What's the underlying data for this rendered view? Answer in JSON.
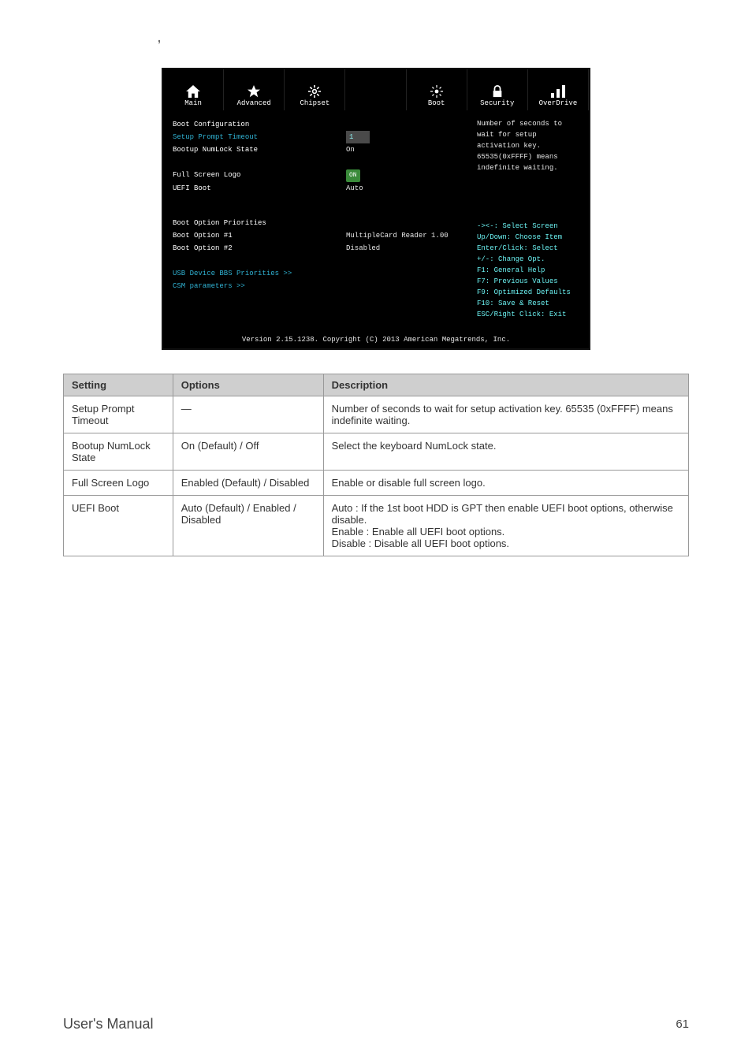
{
  "comma": ",",
  "bios": {
    "tabs": [
      {
        "label": "Main",
        "icon": "home"
      },
      {
        "label": "Advanced",
        "icon": "star"
      },
      {
        "label": "Chipset",
        "icon": "gear"
      },
      {
        "label": "",
        "icon": ""
      },
      {
        "label": "Boot",
        "icon": "sun"
      },
      {
        "label": "Security",
        "icon": "lock"
      },
      {
        "label": "OverDrive",
        "icon": "bars"
      }
    ],
    "boot_config_header": "Boot Configuration",
    "setup_prompt_label": "Setup Prompt Timeout",
    "setup_prompt_val": "1",
    "numlock_label": "Bootup NumLock State",
    "numlock_val": "On",
    "full_logo_label": "Full Screen Logo",
    "full_logo_val": "ON",
    "uefi_label": "UEFI Boot",
    "uefi_val": "Auto",
    "boot_prio_header": "Boot Option Priorities",
    "boot1_label": "Boot Option #1",
    "boot1_val": "MultipleCard Reader 1.00",
    "boot2_label": "Boot Option #2",
    "boot2_val": "Disabled",
    "usb_prio": "USB Device BBS Priorities >>",
    "csm": "CSM parameters >>",
    "right_desc": "Number of seconds to wait for setup activation key. 65535(0xFFFF) means indefinite waiting.",
    "help": [
      "-><-: Select Screen",
      "Up/Down: Choose Item",
      "Enter/Click: Select",
      "+/-: Change Opt.",
      "F1:  General Help",
      "F7:  Previous Values",
      "F9:  Optimized Defaults",
      "F10: Save & Reset",
      "ESC/Right Click: Exit"
    ],
    "footer": "Version 2.15.1238. Copyright (C) 2013 American Megatrends, Inc."
  },
  "table": {
    "headers": [
      "Setting",
      "Options",
      "Description"
    ],
    "rows": [
      {
        "s": "Setup Prompt Timeout",
        "o": "—",
        "d": "Number of seconds to wait for setup activation key. 65535 (0xFFFF) means indefinite waiting."
      },
      {
        "s": "Bootup NumLock State",
        "o": "On (Default) / Off",
        "d": "Select the keyboard NumLock state."
      },
      {
        "s": "Full Screen Logo",
        "o": "Enabled (Default) / Disabled",
        "d": "Enable or disable full screen logo."
      },
      {
        "s": "UEFI Boot",
        "o": "Auto (Default) / Enabled / Disabled",
        "d": "Auto : If the 1st boot HDD is GPT then enable UEFI boot options, otherwise disable.\nEnable : Enable all UEFI boot options.\nDisable : Disable all UEFI boot options."
      }
    ]
  },
  "footer_label": "User's Manual",
  "page_no": "61"
}
